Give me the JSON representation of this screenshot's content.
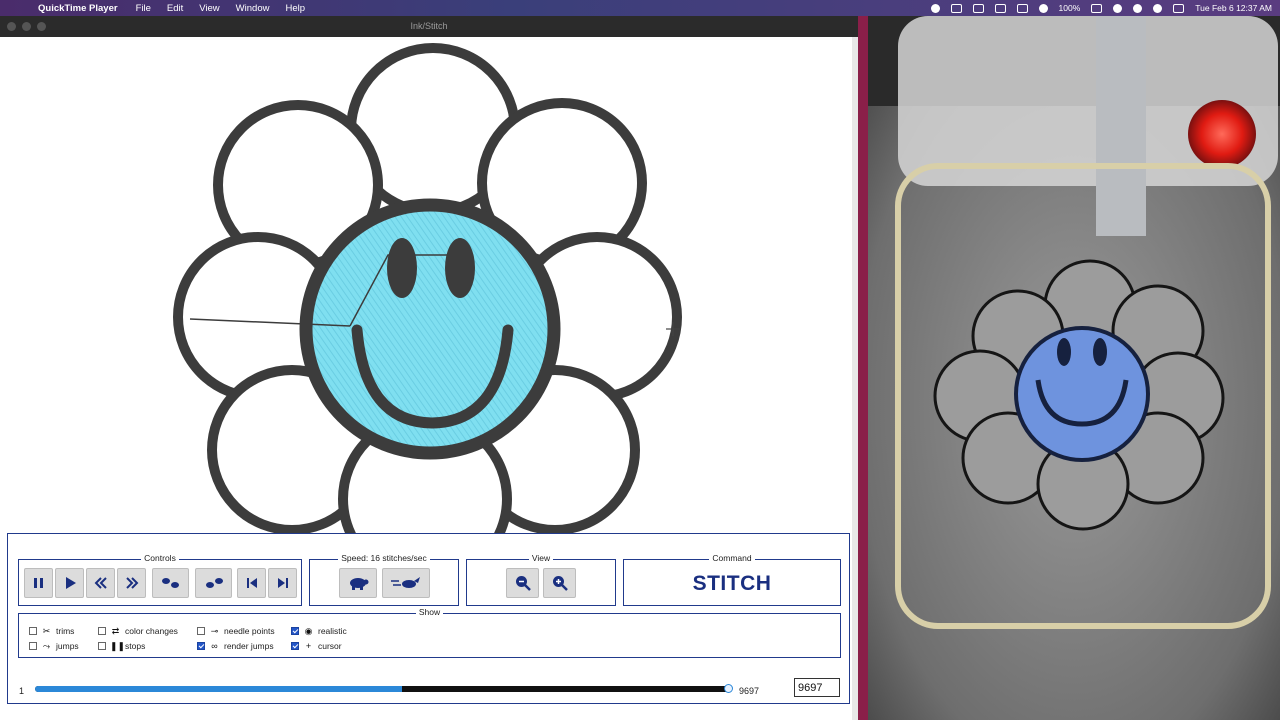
{
  "menubar": {
    "app_name": "QuickTime Player",
    "items": [
      "File",
      "Edit",
      "View",
      "Window",
      "Help"
    ],
    "battery": "100%",
    "datetime": "Tue Feb 6  12:37 AM"
  },
  "window": {
    "title": "Ink/Stitch"
  },
  "controls": {
    "title": "Controls",
    "buttons": [
      "pause-icon",
      "play-icon",
      "rewind-icon",
      "fast-forward-icon",
      "step-back-icon",
      "step-forward-icon",
      "skip-to-start-icon",
      "skip-to-end-icon"
    ]
  },
  "speed": {
    "title": "Speed: 16 stitches/sec",
    "buttons": [
      "slower-turtle-icon",
      "faster-hare-icon"
    ]
  },
  "view": {
    "title": "View",
    "buttons": [
      "zoom-out-icon",
      "zoom-in-icon"
    ]
  },
  "command": {
    "title": "Command",
    "value": "STITCH"
  },
  "show": {
    "title": "Show",
    "options": [
      {
        "label": "trims",
        "checked": false,
        "icon": "scissors-icon"
      },
      {
        "label": "jumps",
        "checked": false,
        "icon": "jump-icon"
      },
      {
        "label": "color changes",
        "checked": false,
        "icon": "swap-icon"
      },
      {
        "label": "stops",
        "checked": false,
        "icon": "stop-icon"
      },
      {
        "label": "needle points",
        "checked": false,
        "icon": "needle-point-icon"
      },
      {
        "label": "render jumps",
        "checked": true,
        "icon": "link-icon"
      },
      {
        "label": "realistic",
        "checked": true,
        "icon": "eye-icon"
      },
      {
        "label": "cursor",
        "checked": true,
        "icon": "crosshair-icon"
      }
    ]
  },
  "slider": {
    "min": "1",
    "max": "9697",
    "value": 9697,
    "fill_fraction": 0.53
  },
  "frame_input": {
    "value": "9697"
  },
  "colors": {
    "accent": "#213a8c",
    "face": "#7fdff0",
    "outline": "#3a3a3a",
    "slider": "#2b88d8"
  }
}
